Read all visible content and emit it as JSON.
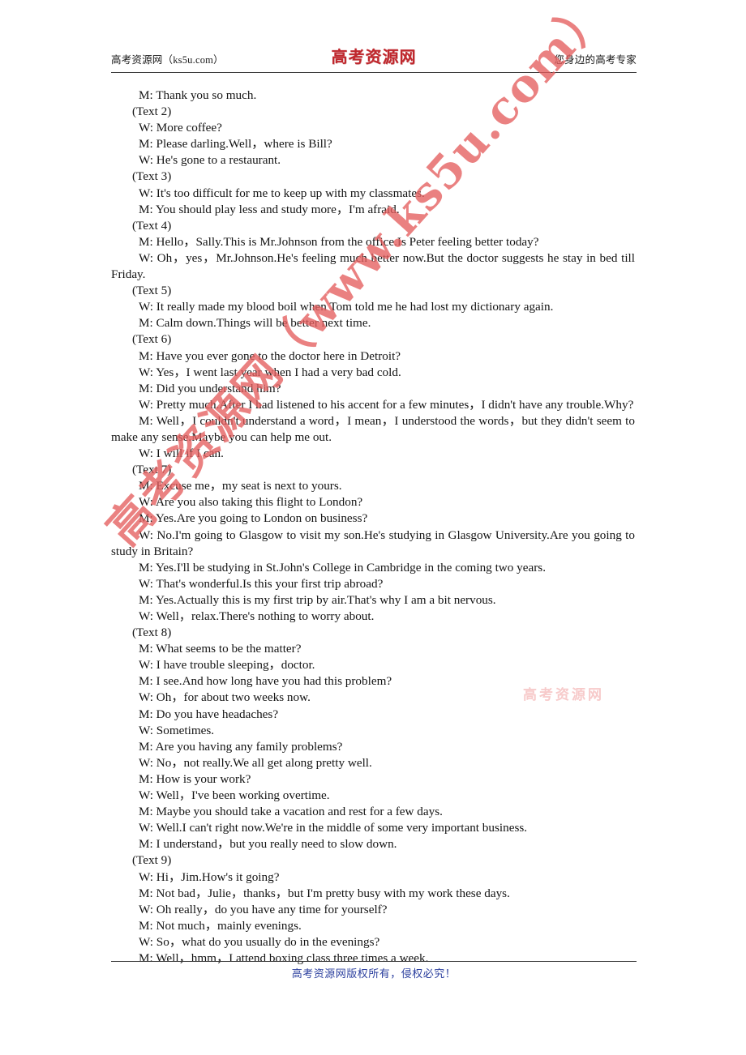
{
  "header": {
    "left_text": "高考资源网（ks5u.com）",
    "logo_text": "高考资源网",
    "right_text": "您身边的高考专家",
    "logo_color": "#c0272d"
  },
  "footer": {
    "text": "高考资源网版权所有，侵权必究！",
    "color": "#2b3f9e"
  },
  "watermark": {
    "diagonal_text": "高考资源网（www.ks5u.com）",
    "small_text": "高考资源网",
    "color": "#e45e5e"
  },
  "body": {
    "lines": [
      {
        "type": "single",
        "text": "M: Thank you so much."
      },
      {
        "type": "marker",
        "text": "(Text 2)"
      },
      {
        "type": "single",
        "text": "W: More coffee?"
      },
      {
        "type": "single",
        "text": "M: Please darling.Well，where is Bill?"
      },
      {
        "type": "single",
        "text": "W: He's gone to a restaurant."
      },
      {
        "type": "marker",
        "text": "(Text 3)"
      },
      {
        "type": "single",
        "text": "W: It's too difficult for me to keep up with my classmates."
      },
      {
        "type": "single",
        "text": "M: You should play less and study more，I'm afraid."
      },
      {
        "type": "marker",
        "text": "(Text 4)"
      },
      {
        "type": "single",
        "text": "M: Hello，Sally.This is Mr.Johnson from the office.Is Peter feeling better today?"
      },
      {
        "type": "wrap",
        "text": "W: Oh，yes，Mr.Johnson.He's feeling much better now.But the doctor suggests he stay in bed till Friday."
      },
      {
        "type": "marker",
        "text": "(Text 5)"
      },
      {
        "type": "single",
        "text": "W: It really made my blood boil when Tom told me he had lost my dictionary again."
      },
      {
        "type": "single",
        "text": "M: Calm down.Things will be better next time."
      },
      {
        "type": "marker",
        "text": "(Text 6)"
      },
      {
        "type": "single",
        "text": "M: Have you ever gone to the doctor here in Detroit?"
      },
      {
        "type": "single",
        "text": "W: Yes，I went last year when I had a very bad cold."
      },
      {
        "type": "single",
        "text": "M: Did you understand him?"
      },
      {
        "type": "wrap",
        "text": "W: Pretty much.After I had listened to his accent for a few minutes，I didn't have any trouble.Why?"
      },
      {
        "type": "wrap",
        "text": "M: Well，I couldn't understand a word，I mean，I understood the words，but they didn't seem to make any sense.Maybe you can help me out."
      },
      {
        "type": "single",
        "text": "W: I will if I can."
      },
      {
        "type": "marker",
        "text": "(Text 7)"
      },
      {
        "type": "single",
        "text": "M: Excuse me，my seat is next to yours."
      },
      {
        "type": "single",
        "text": "W: Are you also taking this flight to London?"
      },
      {
        "type": "single",
        "text": "M: Yes.Are you going to London on business?"
      },
      {
        "type": "wrap",
        "text": "W: No.I'm going to Glasgow to visit my son.He's studying in Glasgow University.Are you going to study in Britain?"
      },
      {
        "type": "single",
        "text": "M: Yes.I'll be studying in St.John's College in Cambridge in the coming two years."
      },
      {
        "type": "single",
        "text": "W: That's wonderful.Is this your first trip abroad?"
      },
      {
        "type": "single",
        "text": "M: Yes.Actually this is my first trip by air.That's why I am a bit nervous."
      },
      {
        "type": "single",
        "text": "W: Well，relax.There's nothing to worry about."
      },
      {
        "type": "marker",
        "text": "(Text 8)"
      },
      {
        "type": "single",
        "text": "M: What seems to be the matter?"
      },
      {
        "type": "single",
        "text": "W: I have trouble sleeping，doctor."
      },
      {
        "type": "single",
        "text": "M: I see.And how long have you had this problem?"
      },
      {
        "type": "single",
        "text": "W: Oh，for about two weeks now."
      },
      {
        "type": "single",
        "text": "M: Do you have headaches?"
      },
      {
        "type": "single",
        "text": "W: Sometimes."
      },
      {
        "type": "single",
        "text": "M: Are you having any family problems?"
      },
      {
        "type": "single",
        "text": "W: No，not really.We all get along pretty well."
      },
      {
        "type": "single",
        "text": "M: How is your work?"
      },
      {
        "type": "single",
        "text": "W: Well，I've been working overtime."
      },
      {
        "type": "single",
        "text": "M: Maybe you should take a vacation and rest for a few days."
      },
      {
        "type": "single",
        "text": "W: Well.I can't right now.We're in the middle of some very important business."
      },
      {
        "type": "single",
        "text": "M: I understand，but you really need to slow down."
      },
      {
        "type": "marker",
        "text": "(Text 9)"
      },
      {
        "type": "single",
        "text": "W: Hi，Jim.How's it going?"
      },
      {
        "type": "single",
        "text": "M: Not bad，Julie，thanks，but I'm pretty busy with my work these days."
      },
      {
        "type": "single",
        "text": "W: Oh really，do you have any time for yourself?"
      },
      {
        "type": "single",
        "text": "M: Not much，mainly evenings."
      },
      {
        "type": "single",
        "text": "W: So，what do you usually do in the evenings?"
      },
      {
        "type": "single",
        "text": "M: Well，hmm，I attend boxing class three times a week."
      }
    ]
  }
}
